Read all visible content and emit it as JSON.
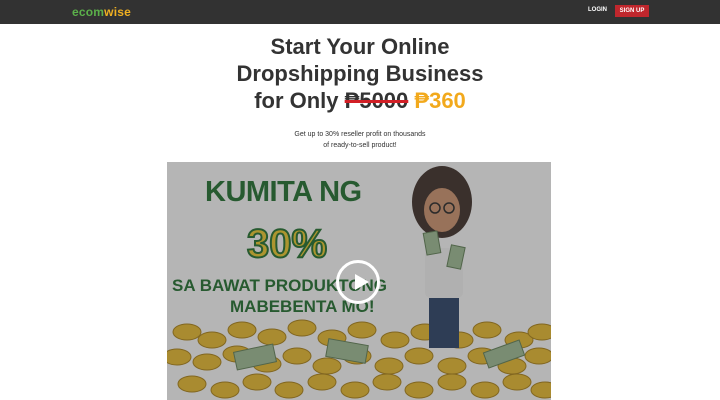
{
  "nav": {
    "logo_part1": "ecom",
    "logo_part2": "wise",
    "login": "LOGIN",
    "signup": "SIGN UP"
  },
  "hero": {
    "line1": "Start Your Online",
    "line2": "Dropshipping Business",
    "line3_prefix": "for Only",
    "old_price": "₱5000",
    "new_price": "₱360",
    "sub_line1": "Get up to 30% reseller profit on thousands",
    "sub_line2": "of ready-to-sell product!"
  },
  "video": {
    "title1": "KUMITA NG",
    "percent": "30%",
    "title2": "SA BAWAT PRODUKTONG",
    "title3": "MABEBENTA MO!",
    "play_icon": "play-icon"
  },
  "colors": {
    "navbar": "#323232",
    "logo_green": "#5bb04a",
    "logo_gold": "#f0b021",
    "signup_red": "#c0272d",
    "price_gold": "#f2a91c",
    "strike_red": "#d21f26",
    "video_green": "#1d6b2a",
    "coin_gold": "#e8c528"
  }
}
